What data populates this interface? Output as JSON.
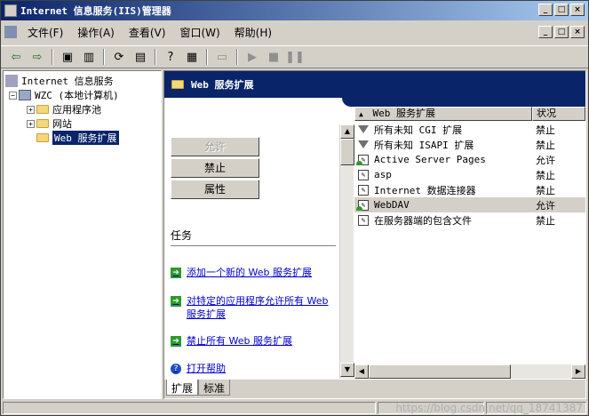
{
  "window": {
    "title": "Internet 信息服务(IIS)管理器"
  },
  "title_buttons": [
    "_",
    "□",
    "×"
  ],
  "menu": [
    "文件(F)",
    "操作(A)",
    "查看(V)",
    "窗口(W)",
    "帮助(H)"
  ],
  "tree": {
    "root": "Internet 信息服务",
    "computer": "WZC (本地计算机)",
    "app_pools": "应用程序池",
    "websites": "网站",
    "web_ext": "Web 服务扩展"
  },
  "panel": {
    "header": "Web 服务扩展",
    "buttons": {
      "allow": "允许",
      "deny": "禁止",
      "props": "属性"
    },
    "tasks_label": "任务",
    "tasks": [
      "添加一个新的 Web 服务扩展",
      "对特定的应用程序允许所有 Web 服务扩展",
      "禁止所有 Web 服务扩展",
      "打开帮助"
    ]
  },
  "list": {
    "columns": [
      "Web 服务扩展",
      "状况"
    ],
    "rows": [
      {
        "name": "所有未知 CGI 扩展",
        "status": "禁止",
        "icon": "funnel-icon"
      },
      {
        "name": "所有未知 ISAPI 扩展",
        "status": "禁止",
        "icon": "funnel-icon"
      },
      {
        "name": "Active Server Pages",
        "status": "允许",
        "icon": "extension-allowed-icon"
      },
      {
        "name": "asp",
        "status": "禁止",
        "icon": "extension-icon"
      },
      {
        "name": "Internet 数据连接器",
        "status": "禁止",
        "icon": "extension-icon"
      },
      {
        "name": "WebDAV",
        "status": "允许",
        "icon": "extension-allowed-icon"
      },
      {
        "name": "在服务器端的包含文件",
        "status": "禁止",
        "icon": "extension-icon"
      }
    ]
  },
  "tabs": [
    "扩展",
    "标准"
  ],
  "watermark": "https://blog.csdn.net/qq_18741387"
}
